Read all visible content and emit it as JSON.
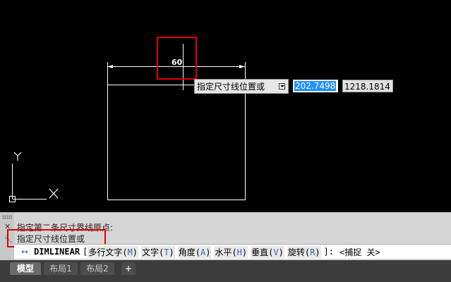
{
  "canvas": {
    "dimension_value": "60",
    "tooltip_prompt": "指定尺寸线位置或",
    "input_active_value": "202.7498",
    "input_second_value": "1218.1814",
    "ucs_y_label": "Y",
    "ucs_x_label": "X"
  },
  "command": {
    "history": [
      "指定第二条尺寸界线原点:",
      "指定尺寸线位置或"
    ],
    "prompt_arrow": "↔",
    "command_name": "DIMLINEAR",
    "bracket_open": "[",
    "options": [
      {
        "label": "多行文字(",
        "key": "M",
        "close": ")"
      },
      {
        "label": "文字(",
        "key": "T",
        "close": ")"
      },
      {
        "label": "角度(",
        "key": "A",
        "close": ")"
      },
      {
        "label": "水平(",
        "key": "H",
        "close": ")"
      },
      {
        "label": "垂直(",
        "key": "V",
        "close": ")"
      },
      {
        "label": "旋转(",
        "key": "R",
        "close": ")"
      }
    ],
    "bracket_close": "]:",
    "snap_status": "<捕捉 关>"
  },
  "tabs": [
    {
      "label": "模型",
      "active": true
    },
    {
      "label": "布局1",
      "active": false
    },
    {
      "label": "布局2",
      "active": false
    }
  ],
  "add_tab_label": "+",
  "icons": {
    "close": "close-icon",
    "customize": "wrench-icon",
    "dropdown": "dropdown-icon"
  },
  "colors": {
    "canvas_bg": "#000000",
    "highlight_red": "#e00000",
    "selection_blue": "#1e90ff",
    "cmd_bg": "#d6d6d6"
  }
}
